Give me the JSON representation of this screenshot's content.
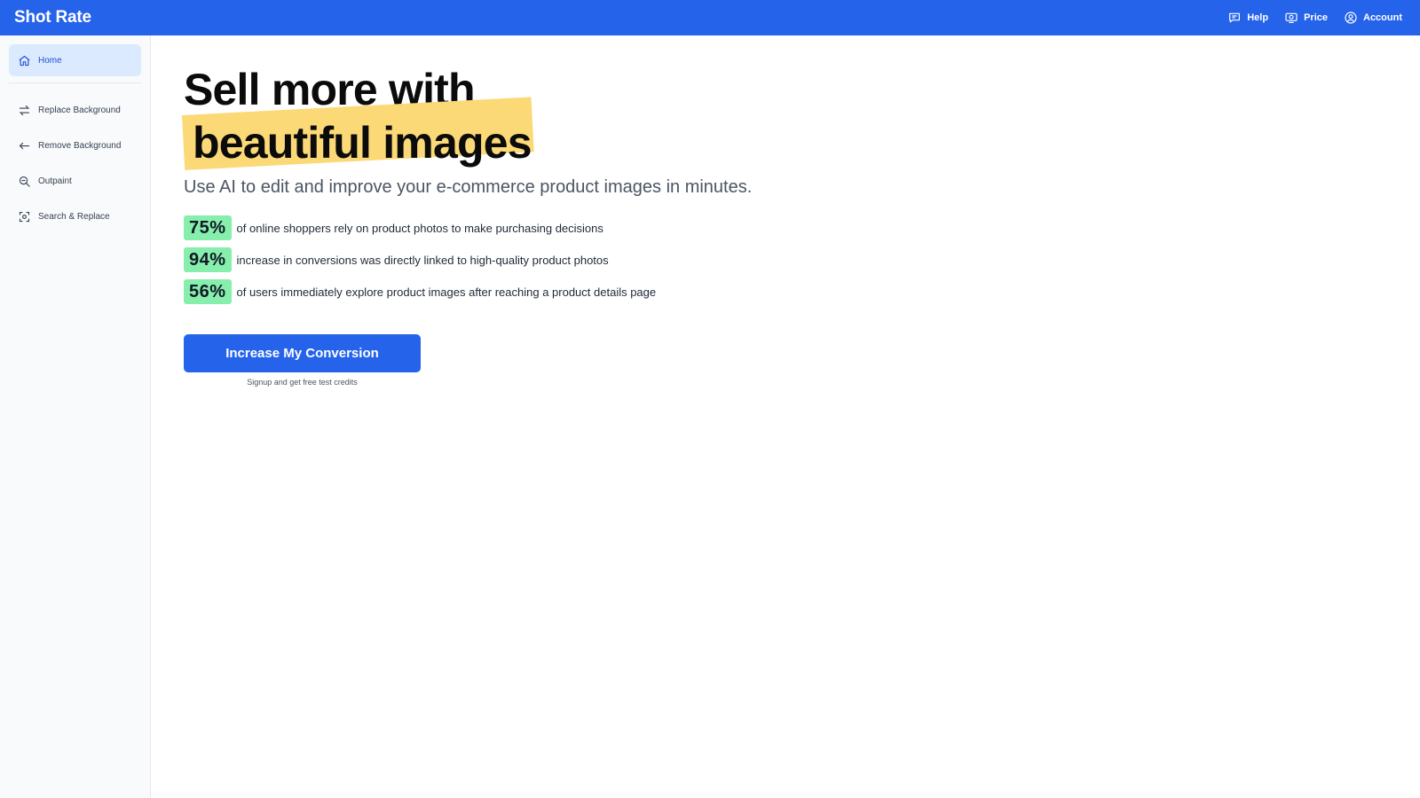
{
  "header": {
    "brand": "Shot Rate",
    "nav": [
      {
        "label": "Help",
        "icon": "chat-bubble-icon"
      },
      {
        "label": "Price",
        "icon": "price-tag-icon"
      },
      {
        "label": "Account",
        "icon": "user-circle-icon"
      }
    ]
  },
  "sidebar": {
    "items": [
      {
        "label": "Home",
        "icon": "home-icon",
        "active": true
      },
      {
        "label": "Replace Background",
        "icon": "swap-arrows-icon"
      },
      {
        "label": "Remove Background",
        "icon": "arrow-left-icon"
      },
      {
        "label": "Outpaint",
        "icon": "magnify-icon"
      },
      {
        "label": "Search & Replace",
        "icon": "focus-scan-icon"
      }
    ]
  },
  "hero": {
    "headline_line1": "Sell more with",
    "headline_line2": "beautiful images",
    "subtitle": "Use AI to edit and improve your e-commerce product images in minutes.",
    "stats": [
      {
        "value": "75%",
        "text": "of online shoppers rely on product photos to make purchasing decisions"
      },
      {
        "value": "94%",
        "text": "increase in conversions was directly linked to high-quality product photos"
      },
      {
        "value": "56%",
        "text": "of users immediately explore product images after reaching a product details page"
      }
    ],
    "cta_label": "Increase My Conversion",
    "cta_note": "Signup and get free test credits"
  },
  "colors": {
    "primary": "#2563eb",
    "highlight": "#fcd977",
    "stat_badge": "#86efac",
    "sidebar_active": "#dbeafe"
  }
}
